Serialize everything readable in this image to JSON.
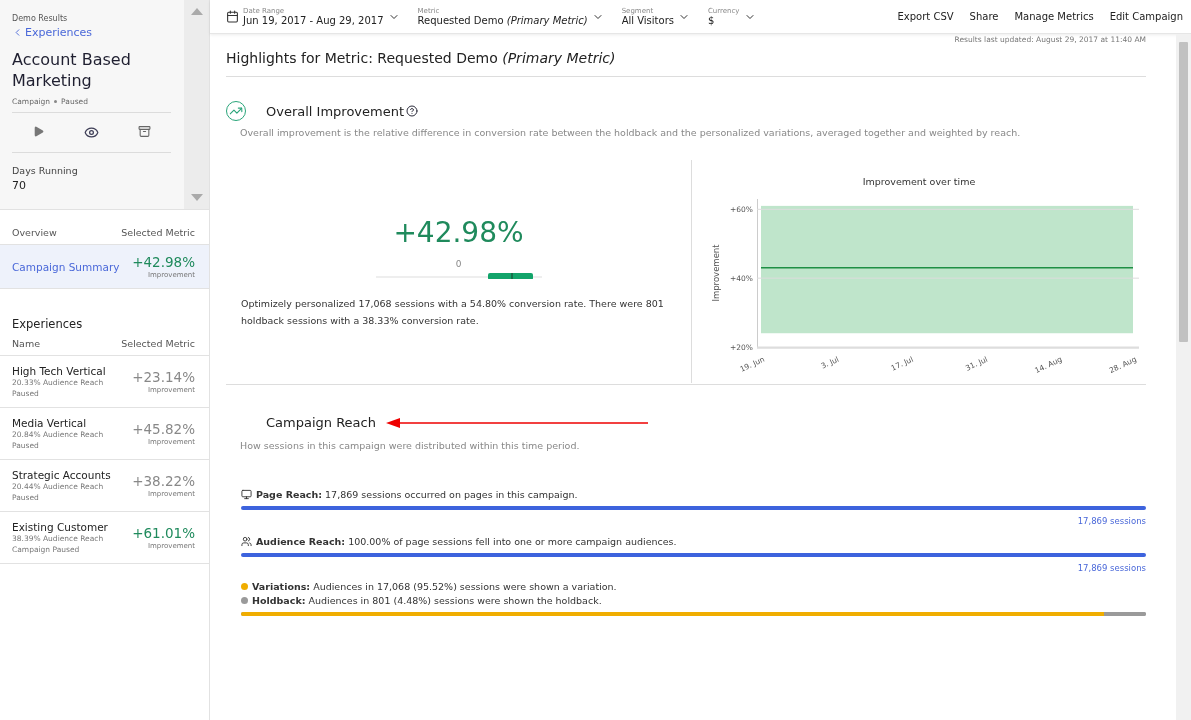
{
  "sidebar": {
    "breadcrumb": "Demo Results",
    "back_link": "Experiences",
    "title": "Account Based Marketing",
    "meta": [
      "Campaign",
      "Paused"
    ],
    "stats": {
      "label": "Days Running",
      "value": "70"
    },
    "overview": {
      "heading": "Overview",
      "metric_heading": "Selected Metric",
      "items": [
        {
          "name": "Campaign Summary",
          "value": "+42.98%",
          "caption": "Improvement",
          "significant": true,
          "selected": true
        }
      ]
    },
    "experiences": {
      "heading": "Experiences",
      "name_heading": "Name",
      "metric_heading": "Selected Metric",
      "items": [
        {
          "name": "High Tech Vertical",
          "reach": "20.33% Audience Reach",
          "status": "Paused",
          "value": "+23.14%",
          "caption": "Improvement",
          "significant": false,
          "selected": false
        },
        {
          "name": "Media Vertical",
          "reach": "20.84% Audience Reach",
          "status": "Paused",
          "value": "+45.82%",
          "caption": "Improvement",
          "significant": false,
          "selected": false
        },
        {
          "name": "Strategic Accounts",
          "reach": "20.44% Audience Reach",
          "status": "Paused",
          "value": "+38.22%",
          "caption": "Improvement",
          "significant": false,
          "selected": false
        },
        {
          "name": "Existing Customer",
          "reach": "38.39% Audience Reach",
          "status": "Campaign Paused",
          "value": "+61.01%",
          "caption": "Improvement",
          "significant": true,
          "selected": false
        }
      ]
    }
  },
  "toolbar": {
    "filters": [
      {
        "kind": "date",
        "label": "Date Range",
        "value": "Jun 19, 2017 - Aug 29, 2017"
      },
      {
        "kind": "plain",
        "label": "Metric",
        "value": "Requested Demo *(Primary Metric)*"
      },
      {
        "kind": "plain",
        "label": "Segment",
        "value": "All Visitors"
      },
      {
        "kind": "plain",
        "label": "Currency",
        "value": "$"
      }
    ],
    "actions": [
      "Export CSV",
      "Share",
      "Manage Metrics",
      "Edit Campaign"
    ]
  },
  "updated": "Results last updated: August 29, 2017 at 11:40 AM",
  "highlights_title": "Highlights for Metric: Requested Demo *(Primary Metric)*",
  "improvement": {
    "title": "Overall Improvement",
    "description": "Overall improvement is the relative difference in conversion rate between the holdback and the personalized variations, averaged together and weighted by reach.",
    "value": "+42.98%",
    "zero_label": "0",
    "summary": "Optimizely personalized 17,068 sessions with a 54.80% conversion rate. There were 801 holdback sessions with a 38.33% conversion rate.",
    "chart_data": {
      "type": "line",
      "title": "Improvement over time",
      "ylabel": "Improvement",
      "categories": [
        "19. Jun",
        "3. Jul",
        "17. Jul",
        "31. Jul",
        "14. Aug",
        "28. Aug"
      ],
      "values": [
        43,
        43,
        43,
        43,
        43,
        43
      ],
      "bands": [
        {
          "axis": "y",
          "from": 24,
          "to": 61,
          "color": "#bfe5cb"
        }
      ],
      "ylim": [
        20,
        63
      ],
      "yticks": [
        {
          "value": 20,
          "label": "+20%"
        },
        {
          "value": 40,
          "label": "+40%"
        },
        {
          "value": 60,
          "label": "+60%"
        }
      ]
    }
  },
  "reach": {
    "title": "Campaign Reach",
    "description": "How sessions in this campaign were distributed within this time period.",
    "rows": [
      {
        "kind": "page",
        "label": "Page Reach:",
        "text": "17,869 sessions occurred on pages in this campaign.",
        "level": 1,
        "total": "17,869 sessions"
      },
      {
        "kind": "audience",
        "label": "Audience Reach:",
        "text": "100.00% of page sessions fell into one or more campaign audiences.",
        "level": 1,
        "total": "17,869 sessions"
      }
    ],
    "split": [
      {
        "label": "Variations:",
        "text": "Audiences in 17,068 (95.52%) sessions were shown a variation.",
        "color": "#f0ad00",
        "level": 0.9552
      },
      {
        "label": "Holdback:",
        "text": "Audiences in 801 (4.48%) sessions were shown the holdback.",
        "color": "#9a9a9a",
        "level": 0.0448
      }
    ]
  }
}
